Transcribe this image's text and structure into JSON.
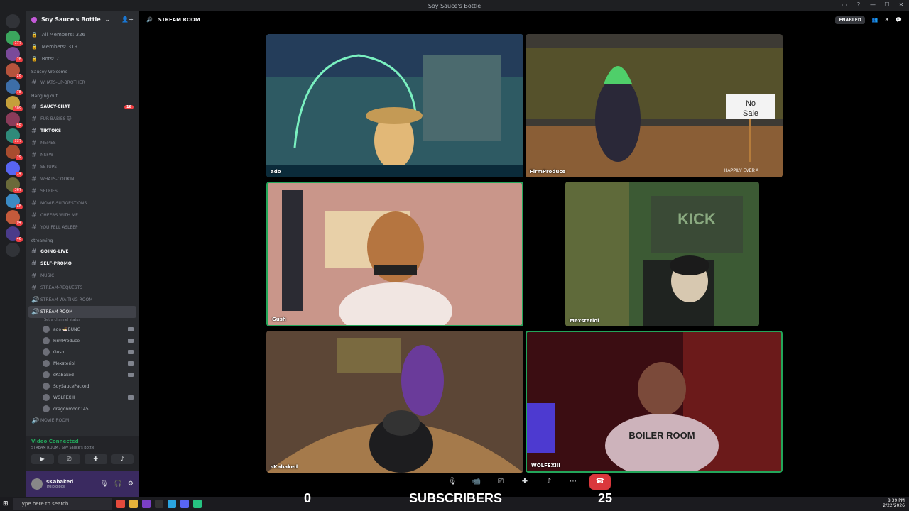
{
  "window": {
    "title": "Soy Sauce's Bottle"
  },
  "server_badges": [
    "177",
    "28",
    "26",
    "78",
    "309",
    "48",
    "337",
    "29",
    "14",
    "367",
    "48",
    "94",
    "46"
  ],
  "guild": {
    "name": "Soy Sauce's Bottle",
    "stats": [
      "All Members: 326",
      "Members: 319",
      "Bots: 7"
    ]
  },
  "categories": {
    "welcome": "Saucey Welcome",
    "hanging": "Hanging out",
    "streaming": "streaming"
  },
  "channels_welcome": [
    {
      "label": "WHATS-UP-BROTHER",
      "icon": "✌"
    }
  ],
  "channels_hanging": [
    {
      "label": "SAUCY-CHAT",
      "unread": true,
      "badge": "16"
    },
    {
      "label": "FUR-BABIES 😺",
      "unread": false
    },
    {
      "label": "TIKTOKS",
      "unread": true
    },
    {
      "label": "MEMES",
      "unread": false
    },
    {
      "label": "NSFW",
      "unread": false
    },
    {
      "label": "SETUPS",
      "unread": false
    },
    {
      "label": "WHATS-COOKIN",
      "unread": false
    },
    {
      "label": "SELFIES",
      "unread": false
    },
    {
      "label": "MOVIE-SUGGESTIONS",
      "unread": false
    },
    {
      "label": "CHEERS WITH ME",
      "unread": false
    },
    {
      "label": "YOU FELL ASLEEP",
      "unread": false
    }
  ],
  "channels_streaming": [
    {
      "label": "GOING-LIVE",
      "unread": true
    },
    {
      "label": "SELF-PROMO",
      "unread": true
    },
    {
      "label": "MUSIC",
      "unread": false
    },
    {
      "label": "STREAM-REQUESTS",
      "unread": false
    },
    {
      "label": "STREAM WAITING ROOM",
      "unread": false,
      "voice": true
    }
  ],
  "active_voice": {
    "label": "STREAM ROOM",
    "status": "Set a channel status"
  },
  "voice_users": [
    "ado 🍜BUNG",
    "FirmProduce",
    "Gush",
    "Mexsteriol",
    "sKabaked",
    "SoySaucePacked",
    "WOLFEXIII",
    "dragonmoon145"
  ],
  "movie_room": "MOVIE ROOM",
  "rtc": {
    "status": "Video Connected",
    "location": "STREAM ROOM / Soy Sauce's Bottle"
  },
  "user": {
    "name": "sKabaked",
    "status": "Trololololol"
  },
  "topbar": {
    "channel": "STREAM ROOM",
    "enabled": "ENABLED",
    "members": "8"
  },
  "tiles": [
    {
      "name": "ado",
      "color": "#3b6e6a"
    },
    {
      "name": "FirmProduce",
      "color": "#7a5a38"
    },
    {
      "name": "Gush",
      "color": "#b88a78"
    },
    {
      "name": "Mexsteriol",
      "color": "#4a7a44"
    },
    {
      "name": "sKabaked",
      "color": "#6b5038"
    },
    {
      "name": "WOLFEXIII",
      "color": "#6a1a22"
    }
  ],
  "tile_text": {
    "no_sale_1": "No",
    "no_sale_2": "Sale",
    "kick": "KICK",
    "boiler": "BOILER ROOM",
    "happily": "HAPPILY EVER A"
  },
  "overlay": {
    "left_count": "0",
    "label": "SUBSCRIBERS",
    "right_count": "25"
  },
  "taskbar": {
    "search": "Type here to search",
    "time": "8:39 PM",
    "date": "2/22/2026"
  }
}
